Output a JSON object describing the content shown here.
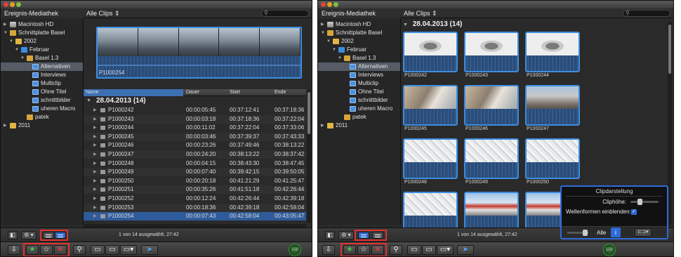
{
  "left": {
    "library_header": "Ereignis-Mediathek",
    "library": [
      {
        "label": "Macintosh HD",
        "tri": "▶",
        "icon": "hd",
        "level": 0
      },
      {
        "label": "Schnittplatte Basel",
        "tri": "▼",
        "icon": "star",
        "level": 0
      },
      {
        "label": "2002",
        "tri": "▼",
        "icon": "folder",
        "level": 1
      },
      {
        "label": "Februar",
        "tri": "▼",
        "icon": "folder-blue",
        "level": 2
      },
      {
        "label": "Basel 1.3",
        "tri": "▼",
        "icon": "star",
        "level": 3
      },
      {
        "label": "Alternativen",
        "tri": "",
        "icon": "keyword",
        "level": 4,
        "selected": true
      },
      {
        "label": "Interviews",
        "tri": "",
        "icon": "keyword",
        "level": 4
      },
      {
        "label": "Multiclip",
        "tri": "",
        "icon": "keyword",
        "level": 4
      },
      {
        "label": "Ohne Titel",
        "tri": "",
        "icon": "keyword",
        "level": 4
      },
      {
        "label": "schnittbilder",
        "tri": "",
        "icon": "keyword",
        "level": 4
      },
      {
        "label": "uheren Macro",
        "tri": "",
        "icon": "keyword",
        "level": 4
      },
      {
        "label": "patek",
        "tri": "",
        "icon": "star",
        "level": 3
      },
      {
        "label": "2011",
        "tri": "▶",
        "icon": "folder",
        "level": 0
      }
    ],
    "filter": "Alle Clips ⇕",
    "preview_clip": "P1000254",
    "columns": {
      "name": "Name",
      "duration": "Dauer",
      "start": "Start",
      "end": "Ende"
    },
    "group": "28.04.2013  (14)",
    "rows": [
      {
        "name": "P1000242",
        "dur": "00:00:05:45",
        "start": "00:37:12:41",
        "end": "00:37:18:36"
      },
      {
        "name": "P1000243",
        "dur": "00:00:03:18",
        "start": "00:37:18:36",
        "end": "00:37:22:04"
      },
      {
        "name": "P1000244",
        "dur": "00:00:11:02",
        "start": "00:37:22:04",
        "end": "00:37:33:06"
      },
      {
        "name": "P1000245",
        "dur": "00:00:03:46",
        "start": "00:37:39:37",
        "end": "00:37:43:33"
      },
      {
        "name": "P1000246",
        "dur": "00:00:23:26",
        "start": "00:37:49:46",
        "end": "00:38:13:22"
      },
      {
        "name": "P1000247",
        "dur": "00:00:24:20",
        "start": "00:38:13:22",
        "end": "00:38:37:42"
      },
      {
        "name": "P1000248",
        "dur": "00:00:04:15",
        "start": "00:38:43:30",
        "end": "00:38:47:45"
      },
      {
        "name": "P1000249",
        "dur": "00:00:07:40",
        "start": "00:39:42:15",
        "end": "00:39:50:05"
      },
      {
        "name": "P1000250",
        "dur": "00:00:20:18",
        "start": "00:41:21:29",
        "end": "00:41:25:47"
      },
      {
        "name": "P1000251",
        "dur": "00:00:35:26",
        "start": "00:41:51:18",
        "end": "00:42:26:44"
      },
      {
        "name": "P1000252",
        "dur": "00:00:12:24",
        "start": "00:42:26:44",
        "end": "00:42:39:18"
      },
      {
        "name": "P1000253",
        "dur": "00:00:18:36",
        "start": "00:42:39:18",
        "end": "00:42:58:04"
      },
      {
        "name": "P1000254",
        "dur": "00:00:07:43",
        "start": "00:42:58:04",
        "end": "00:43:05:47",
        "selected": true
      }
    ],
    "status_text": "1 von 14 ausgewählt, 27:42"
  },
  "right": {
    "library_header": "Ereignis-Mediathek",
    "library": [
      {
        "label": "Macintosh HD",
        "tri": "▶",
        "icon": "hd",
        "level": 0
      },
      {
        "label": "Schnittplatte Basel",
        "tri": "▼",
        "icon": "star",
        "level": 0
      },
      {
        "label": "2002",
        "tri": "▼",
        "icon": "folder",
        "level": 1
      },
      {
        "label": "Februar",
        "tri": "▼",
        "icon": "folder-blue",
        "level": 2
      },
      {
        "label": "Basel 1.3",
        "tri": "▼",
        "icon": "star",
        "level": 3
      },
      {
        "label": "Alternativen",
        "tri": "",
        "icon": "keyword",
        "level": 4,
        "selected": true
      },
      {
        "label": "Interviews",
        "tri": "",
        "icon": "keyword",
        "level": 4
      },
      {
        "label": "Multiclip",
        "tri": "",
        "icon": "keyword",
        "level": 4
      },
      {
        "label": "Ohne Titel",
        "tri": "",
        "icon": "keyword",
        "level": 4
      },
      {
        "label": "schnittbilder",
        "tri": "",
        "icon": "keyword",
        "level": 4
      },
      {
        "label": "uheren Macro",
        "tri": "",
        "icon": "keyword",
        "level": 4
      },
      {
        "label": "patek",
        "tri": "",
        "icon": "star",
        "level": 3
      },
      {
        "label": "2011",
        "tri": "▶",
        "icon": "folder",
        "level": 0
      }
    ],
    "filter": "Alle Clips ⇕",
    "group": "28.04.2013  (14)",
    "thumbs": [
      {
        "name": "P1000242",
        "img": "watch"
      },
      {
        "name": "P1000243",
        "img": "watch"
      },
      {
        "name": "P1000244",
        "img": "watch"
      },
      {
        "name": "P1000245",
        "img": "shop"
      },
      {
        "name": "P1000246",
        "img": "shop"
      },
      {
        "name": "P1000247",
        "img": "street"
      },
      {
        "name": "P1000248",
        "img": "crystal"
      },
      {
        "name": "P1000249",
        "img": "crystal"
      },
      {
        "name": "P1000250",
        "img": "crystal"
      },
      {
        "name": "",
        "img": "crystal"
      },
      {
        "name": "",
        "img": "bus"
      },
      {
        "name": "",
        "img": "bus"
      }
    ],
    "status_text": "1 von 14 ausgewählt, 27:42",
    "popover": {
      "title": "Clipdarstellung",
      "clip_height_label": "Cliphöhe:",
      "waveforms_label": "Wellenformen einblenden:",
      "waveforms_checked": "✓",
      "all_label": "Alle",
      "info_glyph": "i"
    }
  },
  "toolbar": {
    "import_glyph": "⇩",
    "favorite_glyph": "★",
    "unrate_glyph": "☆",
    "reject_glyph": "✕",
    "key_glyph": "⚲",
    "pointer_glyph": "➤",
    "timecode": "100",
    "gear_glyph": "⚙ ▾"
  }
}
